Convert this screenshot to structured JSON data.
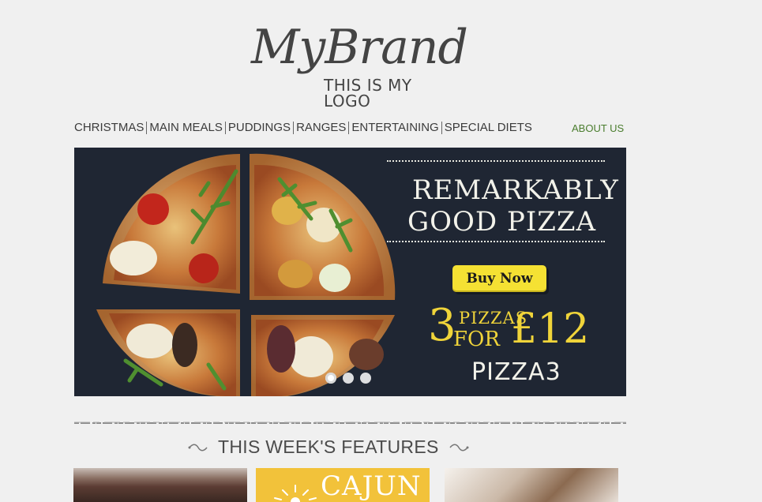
{
  "logo": {
    "script": "MyBrand",
    "tagline": "THIS IS MY LOGO"
  },
  "nav": {
    "items": [
      {
        "label": "CHRISTMAS"
      },
      {
        "label": "MAIN MEALS"
      },
      {
        "label": "PUDDINGS"
      },
      {
        "label": "RANGES"
      },
      {
        "label": "ENTERTAINING"
      },
      {
        "label": "SPECIAL DIETS"
      }
    ],
    "about": "ABOUT US"
  },
  "banner": {
    "headline_line1": "REMARKABLY",
    "headline_line2": "GOOD PIZZA",
    "button_label": "Buy Now",
    "offer_number": "3",
    "offer_pizzas": "PIZZAS",
    "offer_for": "FOR",
    "offer_price": "£12",
    "promo_code": "PIZZA3",
    "slide_count": 3,
    "active_slide": 1,
    "colors": {
      "background": "#1f2633",
      "button": "#f5e133",
      "offer_text": "#f0d43a"
    }
  },
  "features": {
    "title": "THIS WEEK'S FEATURES",
    "cards": [
      {
        "title": ""
      },
      {
        "title": "CAJUN"
      },
      {
        "title": ""
      }
    ]
  },
  "colors": {
    "page_bg": "#f0f0f0",
    "about_link": "#4a7d2e",
    "nav_text": "#3b3b3b"
  }
}
